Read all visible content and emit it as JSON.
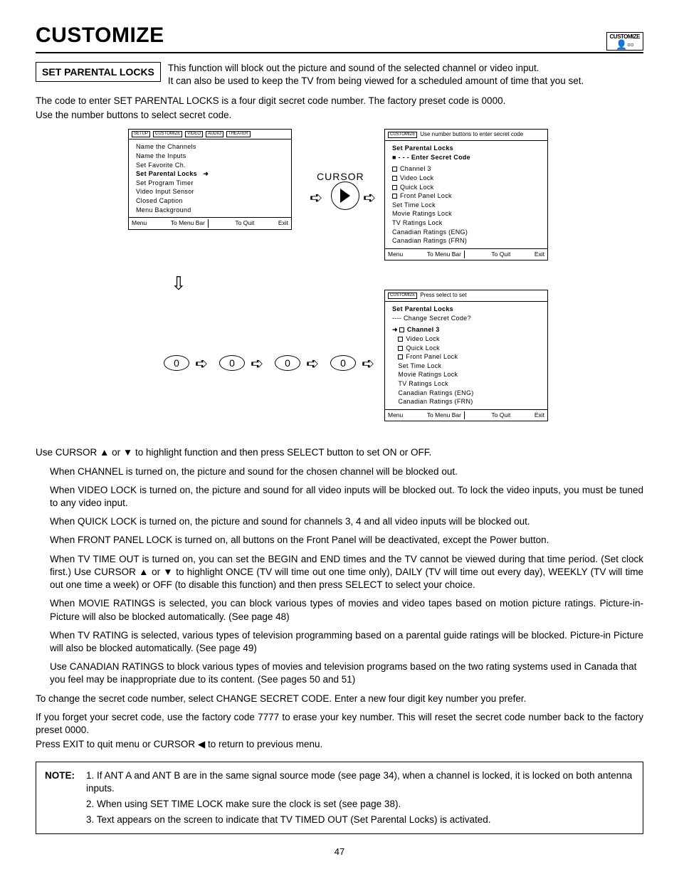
{
  "header": {
    "title": "CUSTOMIZE",
    "corner_icon_label": "CUSTOMIZE"
  },
  "section_box": "SET PARENTAL LOCKS",
  "intro_lines": [
    "This function will block out the picture and sound of the selected channel or video input.",
    "It can also be used to keep the TV from being viewed for a scheduled amount of time that you set."
  ],
  "code_note": "The code to enter SET PARENTAL LOCKS is a four digit secret code number.  The factory preset code is 0000.",
  "code_note2": "Use the number buttons to select secret code.",
  "diagram": {
    "cursor_label": "CURSOR",
    "menu_tabs": [
      "SETUP",
      "CUSTOMIZE",
      "VIDEO",
      "AUDIO",
      "THEATER"
    ],
    "customize_items": [
      "Name the Channels",
      "Name the Inputs",
      "Set Favorite Ch.",
      "Set Parental Locks",
      "Set Program Timer",
      "Video Input Sensor",
      "Closed Caption",
      "Menu Background"
    ],
    "footer": {
      "menu": "Menu",
      "bar": "To Menu Bar",
      "quit": "To Quit",
      "exit": "Exit"
    },
    "screen2_prompt": "Use number buttons to enter secret code",
    "screen2_title": "Set Parental Locks",
    "screen2_enter": "- - -  Enter Secret Code",
    "screen3_prompt": "Press select to set",
    "screen3_change": "----  Change Secret Code?",
    "lock_items": [
      "Channel 3",
      "Video Lock",
      "Quick Lock",
      "Front Panel Lock",
      "Set Time Lock",
      "Movie Ratings Lock",
      "TV Ratings Lock",
      "Canadian Ratings (ENG)",
      "Canadian Ratings (FRN)"
    ],
    "digits": [
      "0",
      "0",
      "0",
      "0"
    ]
  },
  "instructions": {
    "cursor_line": "Use CURSOR ▲ or ▼ to highlight function and then press SELECT button to set ON or OFF.",
    "channel": "When CHANNEL is turned on, the picture and sound for the chosen channel will be blocked out.",
    "video_lock": "When VIDEO LOCK is turned on, the picture and sound for all video inputs will be blocked out. To lock the video inputs, you must be tuned to any video input.",
    "quick_lock": "When QUICK LOCK is turned on, the picture and sound for channels 3, 4 and all video inputs will be blocked out.",
    "front_panel": "When FRONT PANEL LOCK is turned on, all buttons on the Front Panel will be deactivated, except the Power button.",
    "tv_time_out": "When TV TIME OUT is turned on, you can set the BEGIN and END times and the TV cannot be viewed during that time period. (Set clock first.) Use CURSOR ▲ or ▼ to highlight ONCE (TV will time out one time only), DAILY (TV will time out every day), WEEKLY (TV will time out one time a week) or OFF (to disable this function) and then press SELECT to select your choice.",
    "movie_ratings": "When MOVIE RATINGS is selected, you can block various types of movies and video tapes based on motion picture ratings.  Picture-in-Picture will also be blocked automatically. (See page 48)",
    "tv_rating": "When TV RATING is selected, various types of television programming based on a parental guide ratings will be blocked.  Picture-in Picture will also be blocked automatically.  (See page 49)",
    "canadian": "Use CANADIAN RATINGS to block various types of movies and television programs based on the two rating systems used in Canada that you feel may be inappropriate due to its content.  (See pages 50 and 51)",
    "change_code": "To change the secret code number, select CHANGE SECRET CODE.  Enter a new four digit key number you prefer.",
    "forget": "If you forget your secret code, use the factory code 7777 to erase your key number. This will reset the secret code number back to the factory preset 0000.",
    "exit": "Press EXIT to quit menu or CURSOR ◀ to return to previous menu."
  },
  "note": {
    "label": "NOTE:",
    "items": [
      "1. If ANT A and ANT B are in the same signal source mode (see page 34), when a channel is locked, it is locked on both antenna inputs.",
      "2. When using SET TIME LOCK make sure the clock is set (see page 38).",
      "3. Text appears on the screen to indicate that TV TIMED OUT (Set Parental Locks) is activated."
    ]
  },
  "page_number": "47"
}
